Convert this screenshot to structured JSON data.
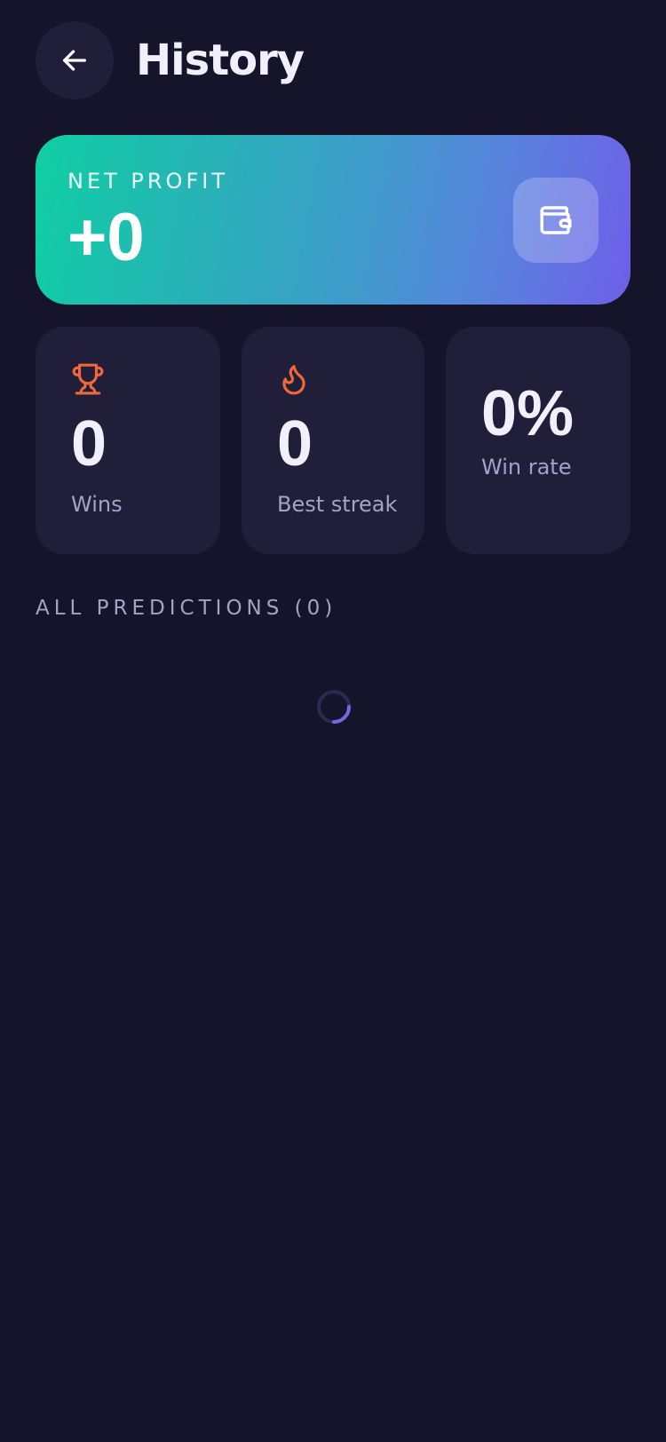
{
  "header": {
    "title": "History",
    "back_icon": "arrow-left-icon"
  },
  "net_profit": {
    "label": "NET PROFIT",
    "value": "+0",
    "icon": "wallet-icon"
  },
  "stats": [
    {
      "icon": "trophy-icon",
      "value": "0",
      "label": "Wins"
    },
    {
      "icon": "flame-icon",
      "value": "0",
      "label": "Best streak"
    },
    {
      "value": "0%",
      "label": "Win rate"
    }
  ],
  "predictions": {
    "section_title": "ALL PREDICTIONS (0)",
    "loading_icon": "loading-spinner-icon"
  },
  "colors": {
    "background": "#15142a",
    "card": "#201e38",
    "accent_orange": "#f0683a",
    "accent_purple": "#6e5fe8",
    "accent_teal": "#0fcfa4",
    "muted_text": "#a6a2c4"
  }
}
